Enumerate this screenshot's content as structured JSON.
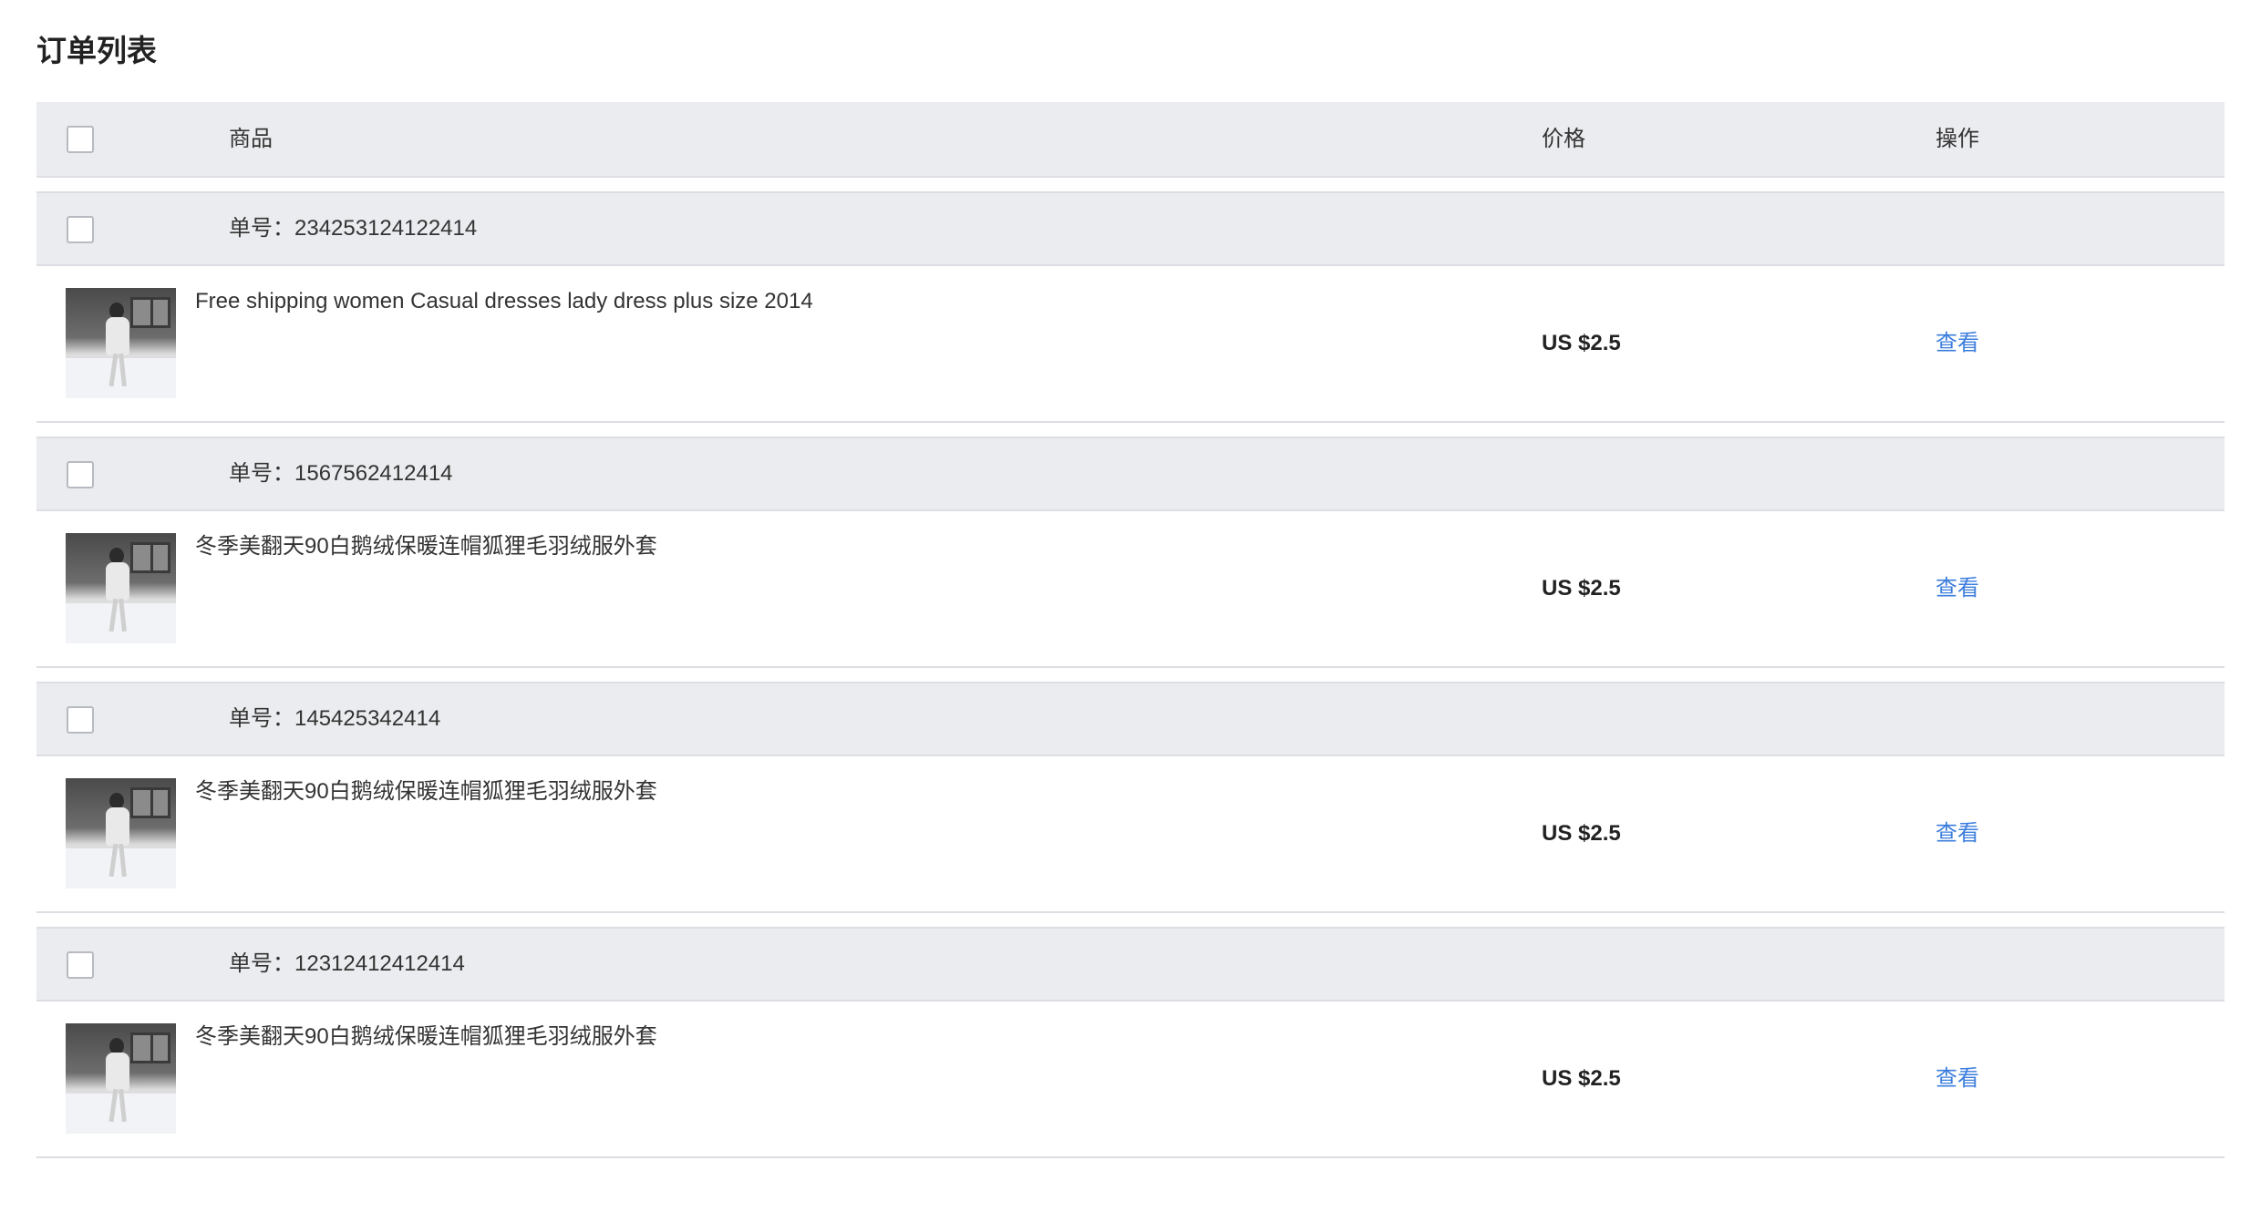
{
  "page": {
    "title": "订单列表"
  },
  "table": {
    "headers": {
      "product": "商品",
      "price": "价格",
      "action": "操作"
    }
  },
  "orders": [
    {
      "order_no": "单号：234253124122414",
      "product_title": "Free shipping women Casual dresses lady dress plus size 2014",
      "price": "US $2.5",
      "action_label": "查看"
    },
    {
      "order_no": "单号：1567562412414",
      "product_title": "冬季美翻天90白鹅绒保暖连帽狐狸毛羽绒服外套",
      "price": "US $2.5",
      "action_label": "查看"
    },
    {
      "order_no": "单号：145425342414",
      "product_title": "冬季美翻天90白鹅绒保暖连帽狐狸毛羽绒服外套",
      "price": "US $2.5",
      "action_label": "查看"
    },
    {
      "order_no": "单号：12312412412414",
      "product_title": "冬季美翻天90白鹅绒保暖连帽狐狸毛羽绒服外套",
      "price": "US $2.5",
      "action_label": "查看"
    }
  ],
  "colors": {
    "header_bg": "#ebecef",
    "link": "#3b7ddd",
    "border": "#dcdee3"
  }
}
